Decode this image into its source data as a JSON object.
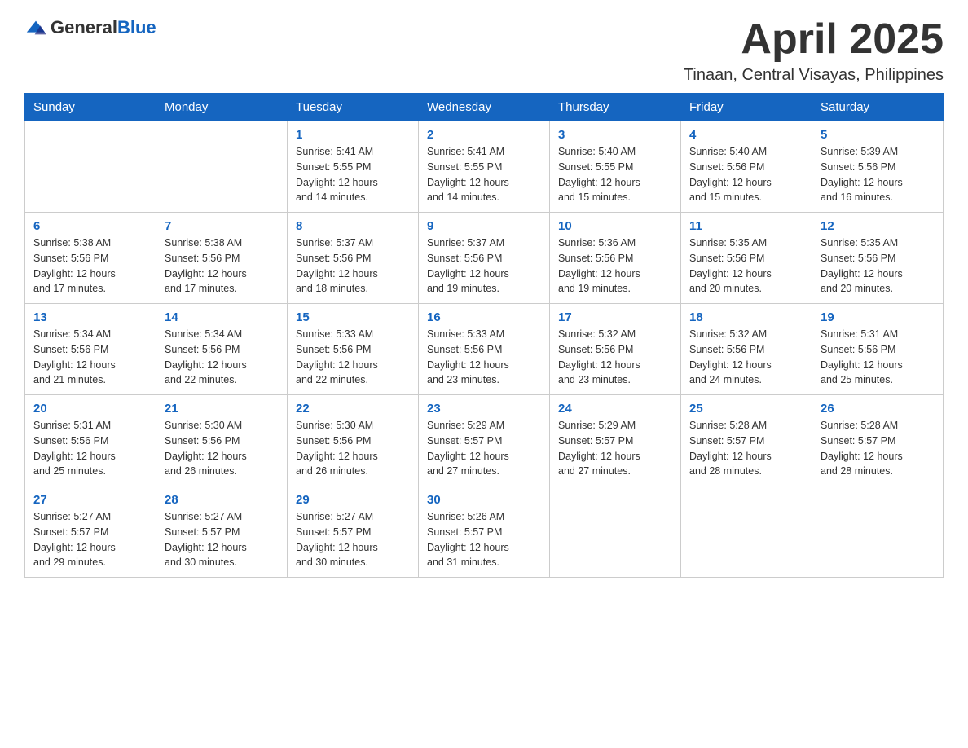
{
  "header": {
    "logo_general": "General",
    "logo_blue": "Blue",
    "month": "April 2025",
    "location": "Tinaan, Central Visayas, Philippines"
  },
  "weekdays": [
    "Sunday",
    "Monday",
    "Tuesday",
    "Wednesday",
    "Thursday",
    "Friday",
    "Saturday"
  ],
  "weeks": [
    [
      {
        "day": "",
        "info": ""
      },
      {
        "day": "",
        "info": ""
      },
      {
        "day": "1",
        "info": "Sunrise: 5:41 AM\nSunset: 5:55 PM\nDaylight: 12 hours\nand 14 minutes."
      },
      {
        "day": "2",
        "info": "Sunrise: 5:41 AM\nSunset: 5:55 PM\nDaylight: 12 hours\nand 14 minutes."
      },
      {
        "day": "3",
        "info": "Sunrise: 5:40 AM\nSunset: 5:55 PM\nDaylight: 12 hours\nand 15 minutes."
      },
      {
        "day": "4",
        "info": "Sunrise: 5:40 AM\nSunset: 5:56 PM\nDaylight: 12 hours\nand 15 minutes."
      },
      {
        "day": "5",
        "info": "Sunrise: 5:39 AM\nSunset: 5:56 PM\nDaylight: 12 hours\nand 16 minutes."
      }
    ],
    [
      {
        "day": "6",
        "info": "Sunrise: 5:38 AM\nSunset: 5:56 PM\nDaylight: 12 hours\nand 17 minutes."
      },
      {
        "day": "7",
        "info": "Sunrise: 5:38 AM\nSunset: 5:56 PM\nDaylight: 12 hours\nand 17 minutes."
      },
      {
        "day": "8",
        "info": "Sunrise: 5:37 AM\nSunset: 5:56 PM\nDaylight: 12 hours\nand 18 minutes."
      },
      {
        "day": "9",
        "info": "Sunrise: 5:37 AM\nSunset: 5:56 PM\nDaylight: 12 hours\nand 19 minutes."
      },
      {
        "day": "10",
        "info": "Sunrise: 5:36 AM\nSunset: 5:56 PM\nDaylight: 12 hours\nand 19 minutes."
      },
      {
        "day": "11",
        "info": "Sunrise: 5:35 AM\nSunset: 5:56 PM\nDaylight: 12 hours\nand 20 minutes."
      },
      {
        "day": "12",
        "info": "Sunrise: 5:35 AM\nSunset: 5:56 PM\nDaylight: 12 hours\nand 20 minutes."
      }
    ],
    [
      {
        "day": "13",
        "info": "Sunrise: 5:34 AM\nSunset: 5:56 PM\nDaylight: 12 hours\nand 21 minutes."
      },
      {
        "day": "14",
        "info": "Sunrise: 5:34 AM\nSunset: 5:56 PM\nDaylight: 12 hours\nand 22 minutes."
      },
      {
        "day": "15",
        "info": "Sunrise: 5:33 AM\nSunset: 5:56 PM\nDaylight: 12 hours\nand 22 minutes."
      },
      {
        "day": "16",
        "info": "Sunrise: 5:33 AM\nSunset: 5:56 PM\nDaylight: 12 hours\nand 23 minutes."
      },
      {
        "day": "17",
        "info": "Sunrise: 5:32 AM\nSunset: 5:56 PM\nDaylight: 12 hours\nand 23 minutes."
      },
      {
        "day": "18",
        "info": "Sunrise: 5:32 AM\nSunset: 5:56 PM\nDaylight: 12 hours\nand 24 minutes."
      },
      {
        "day": "19",
        "info": "Sunrise: 5:31 AM\nSunset: 5:56 PM\nDaylight: 12 hours\nand 25 minutes."
      }
    ],
    [
      {
        "day": "20",
        "info": "Sunrise: 5:31 AM\nSunset: 5:56 PM\nDaylight: 12 hours\nand 25 minutes."
      },
      {
        "day": "21",
        "info": "Sunrise: 5:30 AM\nSunset: 5:56 PM\nDaylight: 12 hours\nand 26 minutes."
      },
      {
        "day": "22",
        "info": "Sunrise: 5:30 AM\nSunset: 5:56 PM\nDaylight: 12 hours\nand 26 minutes."
      },
      {
        "day": "23",
        "info": "Sunrise: 5:29 AM\nSunset: 5:57 PM\nDaylight: 12 hours\nand 27 minutes."
      },
      {
        "day": "24",
        "info": "Sunrise: 5:29 AM\nSunset: 5:57 PM\nDaylight: 12 hours\nand 27 minutes."
      },
      {
        "day": "25",
        "info": "Sunrise: 5:28 AM\nSunset: 5:57 PM\nDaylight: 12 hours\nand 28 minutes."
      },
      {
        "day": "26",
        "info": "Sunrise: 5:28 AM\nSunset: 5:57 PM\nDaylight: 12 hours\nand 28 minutes."
      }
    ],
    [
      {
        "day": "27",
        "info": "Sunrise: 5:27 AM\nSunset: 5:57 PM\nDaylight: 12 hours\nand 29 minutes."
      },
      {
        "day": "28",
        "info": "Sunrise: 5:27 AM\nSunset: 5:57 PM\nDaylight: 12 hours\nand 30 minutes."
      },
      {
        "day": "29",
        "info": "Sunrise: 5:27 AM\nSunset: 5:57 PM\nDaylight: 12 hours\nand 30 minutes."
      },
      {
        "day": "30",
        "info": "Sunrise: 5:26 AM\nSunset: 5:57 PM\nDaylight: 12 hours\nand 31 minutes."
      },
      {
        "day": "",
        "info": ""
      },
      {
        "day": "",
        "info": ""
      },
      {
        "day": "",
        "info": ""
      }
    ]
  ]
}
